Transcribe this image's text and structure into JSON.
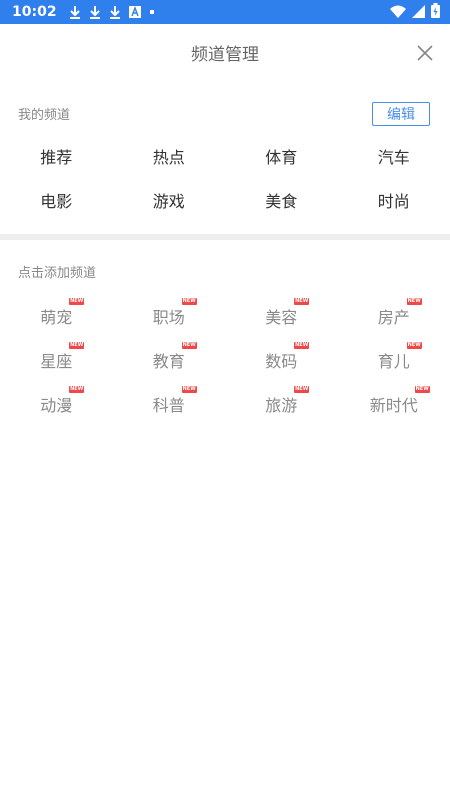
{
  "status_bar": {
    "time": "10:02",
    "icons": [
      "download-icon",
      "download-icon",
      "download-icon",
      "a-icon",
      "dot-icon"
    ],
    "right_icons": [
      "wifi-icon",
      "signal-icon",
      "battery-charging-icon"
    ]
  },
  "header": {
    "title": "频道管理",
    "close_icon": "close-icon"
  },
  "my_channels": {
    "label": "我的频道",
    "edit_label": "编辑",
    "items": [
      "推荐",
      "热点",
      "体育",
      "汽车",
      "电影",
      "游戏",
      "美食",
      "时尚"
    ]
  },
  "add_channels": {
    "label": "点击添加频道",
    "badge_text": "NEW",
    "items": [
      "萌宠",
      "职场",
      "美容",
      "房产",
      "星座",
      "教育",
      "数码",
      "育儿",
      "动漫",
      "科普",
      "旅游",
      "新时代"
    ]
  },
  "colors": {
    "status_bar": "#2f80ec",
    "accent": "#4a8fe6",
    "badge": "#f04848"
  }
}
